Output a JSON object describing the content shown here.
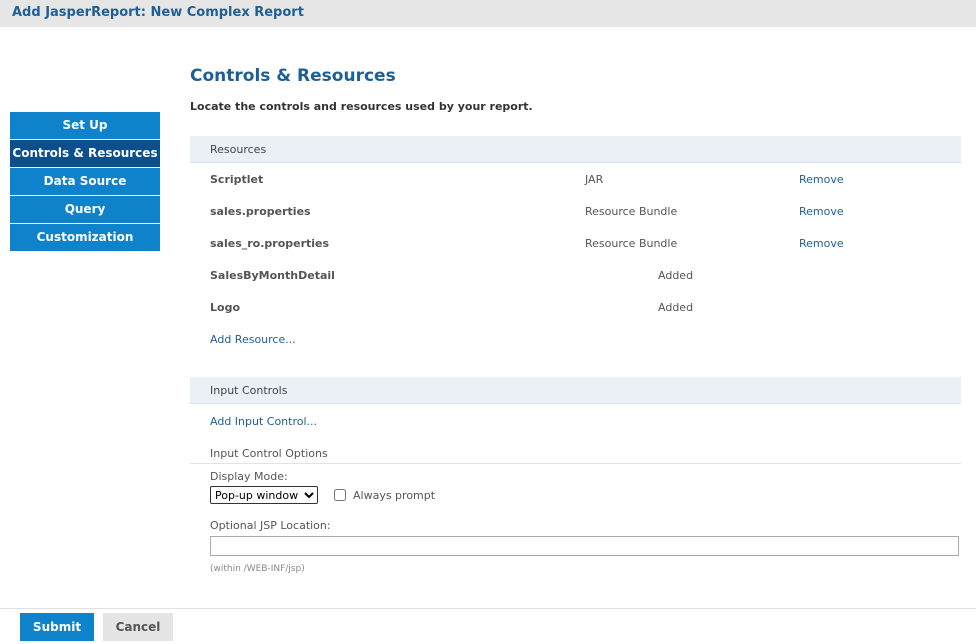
{
  "title": "Add JasperReport: New Complex Report",
  "nav": {
    "items": [
      {
        "label": "Set Up"
      },
      {
        "label": "Controls & Resources"
      },
      {
        "label": "Data Source"
      },
      {
        "label": "Query"
      },
      {
        "label": "Customization"
      }
    ],
    "active": "Controls & Resources"
  },
  "main": {
    "heading": "Controls & Resources",
    "subtitle": "Locate the controls and resources used by your report."
  },
  "resources": {
    "header": "Resources",
    "rows": [
      {
        "name": "Scriptlet",
        "type": "JAR",
        "action": "Remove"
      },
      {
        "name": "sales.properties",
        "type": "Resource Bundle",
        "action": "Remove"
      },
      {
        "name": "sales_ro.properties",
        "type": "Resource Bundle",
        "action": "Remove"
      },
      {
        "name": "SalesByMonthDetail",
        "status": "Added"
      },
      {
        "name": "Logo",
        "status": "Added"
      }
    ],
    "add_link": "Add Resource..."
  },
  "input_controls": {
    "header": "Input Controls",
    "add_link": "Add Input Control...",
    "options_header": "Input Control Options",
    "display_mode_label": "Display Mode:",
    "display_mode_value": "Pop-up window",
    "always_prompt_label": "Always prompt",
    "always_prompt_checked": false,
    "jsp_label": "Optional JSP Location:",
    "jsp_value": "",
    "jsp_hint": "(within /WEB-INF/jsp)"
  },
  "buttons": {
    "submit": "Submit",
    "cancel": "Cancel"
  },
  "colors": {
    "nav_bg": "#0f82cc",
    "nav_active_bg": "#0c4f8c",
    "heading": "#1f5f95",
    "section_bg": "#ebeff6"
  }
}
